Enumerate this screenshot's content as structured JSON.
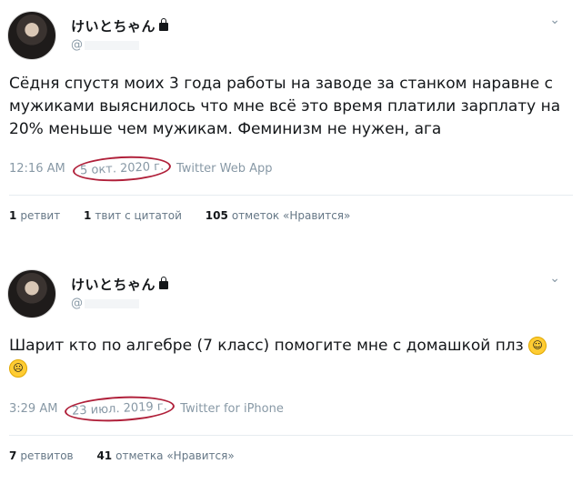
{
  "tweets": [
    {
      "user": {
        "display_name": "けいとちゃん",
        "handle": "@"
      },
      "text": "Сёдня спустя моих 3 года работы на заводе за станком наравне с мужиками выяснилось что мне всё это время платили зарплату на 20% меньше чем мужикам. Феминизм не нужен, ага",
      "time": "12:16 AM",
      "date": "5 окт. 2020 г.",
      "source": "Twitter Web App",
      "stats": [
        {
          "count": "1",
          "label": "ретвит"
        },
        {
          "count": "1",
          "label": "твит с цитатой"
        },
        {
          "count": "105",
          "label": "отметок «Нравится»"
        }
      ]
    },
    {
      "user": {
        "display_name": "けいとちゃん",
        "handle": "@"
      },
      "text": "Шарит кто по алгебре (7 класс) помогите мне с домашкой плз",
      "emojis": [
        "smiling-face-with-halo",
        "sad-but-relieved-face"
      ],
      "time": "3:29 AM",
      "date": "23 июл. 2019 г.",
      "source": "Twitter for iPhone",
      "stats": [
        {
          "count": "7",
          "label": "ретвитов"
        },
        {
          "count": "41",
          "label": "отметка «Нравится»"
        }
      ]
    }
  ],
  "colors": {
    "highlight_circle": "#b0203a",
    "muted": "#8899a6"
  }
}
